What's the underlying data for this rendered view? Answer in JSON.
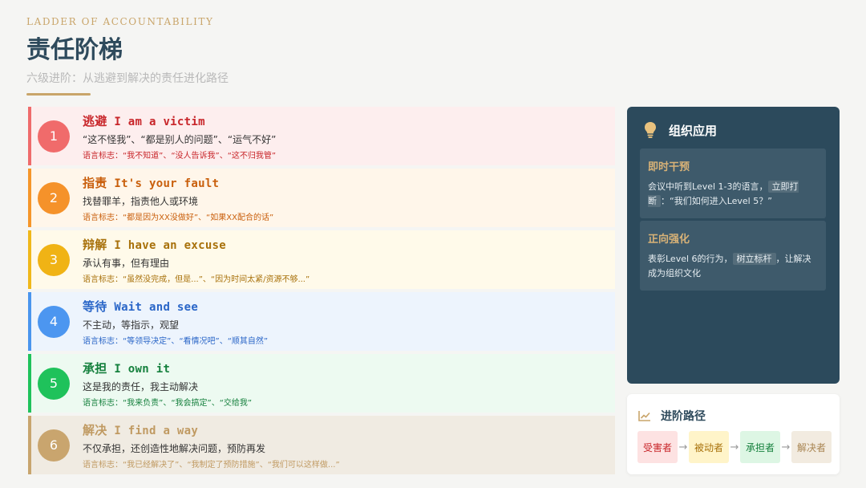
{
  "header": {
    "eyebrow": "LADDER OF ACCOUNTABILITY",
    "title": "责任阶梯",
    "subtitle": "六级进阶：从逃避到解决的责任进化路径"
  },
  "levels": [
    {
      "num": "1",
      "cn": "逃避",
      "en": "I am a victim",
      "desc": "“这不怪我”、“都是别人的问题”、“运气不好”",
      "lang": "语言标志：“我不知道”、“没人告诉我”、“这不归我管”"
    },
    {
      "num": "2",
      "cn": "指责",
      "en": "It's your fault",
      "desc": "找替罪羊，指责他人或环境",
      "lang": "语言标志：“都是因为XX没做好”、“如果XX配合的话”"
    },
    {
      "num": "3",
      "cn": "辩解",
      "en": "I have an excuse",
      "desc": "承认有事，但有理由",
      "lang": "语言标志：“虽然没完成，但是...”、“因为时间太紧/资源不够...”"
    },
    {
      "num": "4",
      "cn": "等待",
      "en": "Wait and see",
      "desc": "不主动，等指示，观望",
      "lang": "语言标志：“等领导决定”、“看情况吧”、“顺其自然”"
    },
    {
      "num": "5",
      "cn": "承担",
      "en": "I own it",
      "desc": "这是我的责任，我主动解决",
      "lang": "语言标志：“我来负责”、“我会搞定”、“交给我”"
    },
    {
      "num": "6",
      "cn": "解决",
      "en": "I find a way",
      "desc": "不仅承担，还创造性地解决问题，预防再发",
      "lang": "语言标志：“我已经解决了”、“我制定了预防措施”、“我们可以这样做...”"
    }
  ],
  "org": {
    "title": "组织应用",
    "icon": "lightbulb-icon",
    "cards": [
      {
        "title": "即时干预",
        "pre": "会议中听到Level 1-3的语言，",
        "hl": "立即打断",
        "post": "：“我们如何进入Level 5？”"
      },
      {
        "title": "正向强化",
        "pre": "表彰Level 6的行为，",
        "hl": "树立标杆",
        "post": "，让解决成为组织文化"
      }
    ]
  },
  "path": {
    "title": "进阶路径",
    "icon": "trend-chart-icon",
    "steps": [
      "受害者",
      "被动者",
      "承担者",
      "解决者"
    ],
    "arrow": "→"
  },
  "colors": {
    "primary": "#2e4a5c",
    "accent": "#c9a56a",
    "level1": "#f06b6b",
    "level2": "#f5922a",
    "level3": "#f0b315",
    "level4": "#4c96f0",
    "level5": "#1fc25b",
    "level6": "#c9a56e"
  }
}
